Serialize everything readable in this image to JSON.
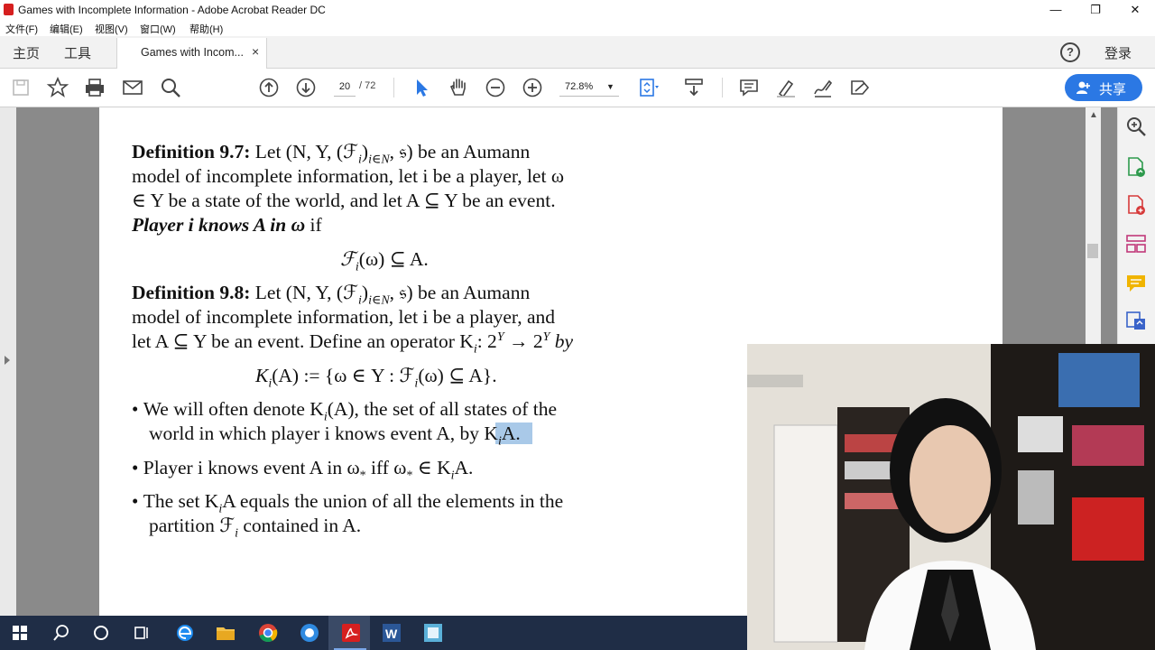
{
  "window": {
    "title": "Games with Incomplete Information - Adobe Acrobat Reader DC",
    "minimize_glyph": "—",
    "restore_glyph": "❐",
    "close_glyph": "✕"
  },
  "menu": [
    "文件(F)",
    "编辑(E)",
    "视图(V)",
    "窗口(W)",
    "帮助(H)"
  ],
  "nav_tabs": {
    "home": "主页",
    "tools": "工具"
  },
  "doc_tab": {
    "label": "Games with Incom...",
    "close": "×"
  },
  "header": {
    "help": "?",
    "login": "登录"
  },
  "toolbar": {
    "page_current": "20",
    "page_total": "/ 72",
    "zoom": "72.8%",
    "share_label": "共享",
    "icons": [
      "save-icon",
      "bookmark-star-icon",
      "print-icon",
      "email-icon",
      "search-icon",
      "page-up-icon",
      "page-down-icon",
      "select-cursor-icon",
      "hand-tool-icon",
      "zoom-out-icon",
      "zoom-in-icon",
      "fit-page-icon",
      "scroll-mode-icon",
      "comment-icon",
      "highlight-pen-icon",
      "sign-icon",
      "fill-sign-icon"
    ]
  },
  "right_panel_icons": [
    "zoom-icon",
    "export-pdf-icon",
    "create-pdf-icon",
    "organize-pages-icon",
    "comment-icon",
    "send-icon"
  ],
  "document": {
    "def97": {
      "label": "Definition 9.7:",
      "line1": "Let (N, Y, (ℱ",
      "line1_sub": "i",
      "line1_subscript2": "i∈N",
      "line1_end": ", 𝔰) be an Aumann",
      "line2": "model of incomplete information, let i be a player, let ω",
      "line3": "∈ Y be a state of the world, and let A ⊆ Y be an event.",
      "line4_bold": "Player i knows A in ω",
      "line4_rest": " if",
      "formula": "ℱ",
      "formula_sub": "i",
      "formula_rest": "(ω) ⊆ A."
    },
    "def98": {
      "label": "Definition 9.8:",
      "line1": "Let (N, Y, (ℱ",
      "line1_sub": "i",
      "line1_subscript2": "i∈N",
      "line1_end": ", 𝔰) be an Aumann",
      "line2": "model of incomplete information, let i be a player, and",
      "line3": "let A ⊆ Y be an event. Define an operator K",
      "line3_sub": "i",
      "line3_end": ": 2",
      "line3_sup": "Y",
      "line3_arrow": " → 2",
      "line3_sup2": "Y",
      "line3_by": " by",
      "formula_pre": "K",
      "formula_sub": "i",
      "formula_mid": "(A) := {ω ∈ Y : ℱ",
      "formula_sub2": "i",
      "formula_end": "(ω) ⊆ A}."
    },
    "bullets": [
      {
        "a": "We will often denote K",
        "sub": "i",
        "b": "(A), the set of all states of the"
      },
      {
        "a": "world in which player i knows event A, by K",
        "sub": "i",
        "b": "A."
      },
      {
        "a": "Player i knows event A in ω",
        "sub": "*",
        "b": " iff ω",
        "sub2": "*",
        "c": " ∈ K",
        "sub3": "i",
        "d": "A."
      },
      {
        "a": "The set K",
        "sub": "i",
        "b": "A equals the union of all the elements in the"
      },
      {
        "a": "partition ℱ",
        "sub": "i",
        "b": " contained in A."
      }
    ]
  },
  "taskbar": {
    "icons": [
      "windows-start-icon",
      "search-icon",
      "cortana-icon",
      "task-view-icon",
      "edge-icon",
      "file-explorer-icon",
      "chrome-icon",
      "browser-icon",
      "acrobat-icon",
      "word-icon",
      "app-icon"
    ]
  },
  "colors": {
    "accent": "#2b78e4",
    "taskbar": "#1f2d46",
    "viewer_bg": "#8a8a8a",
    "highlight": "#a9c9e8"
  }
}
